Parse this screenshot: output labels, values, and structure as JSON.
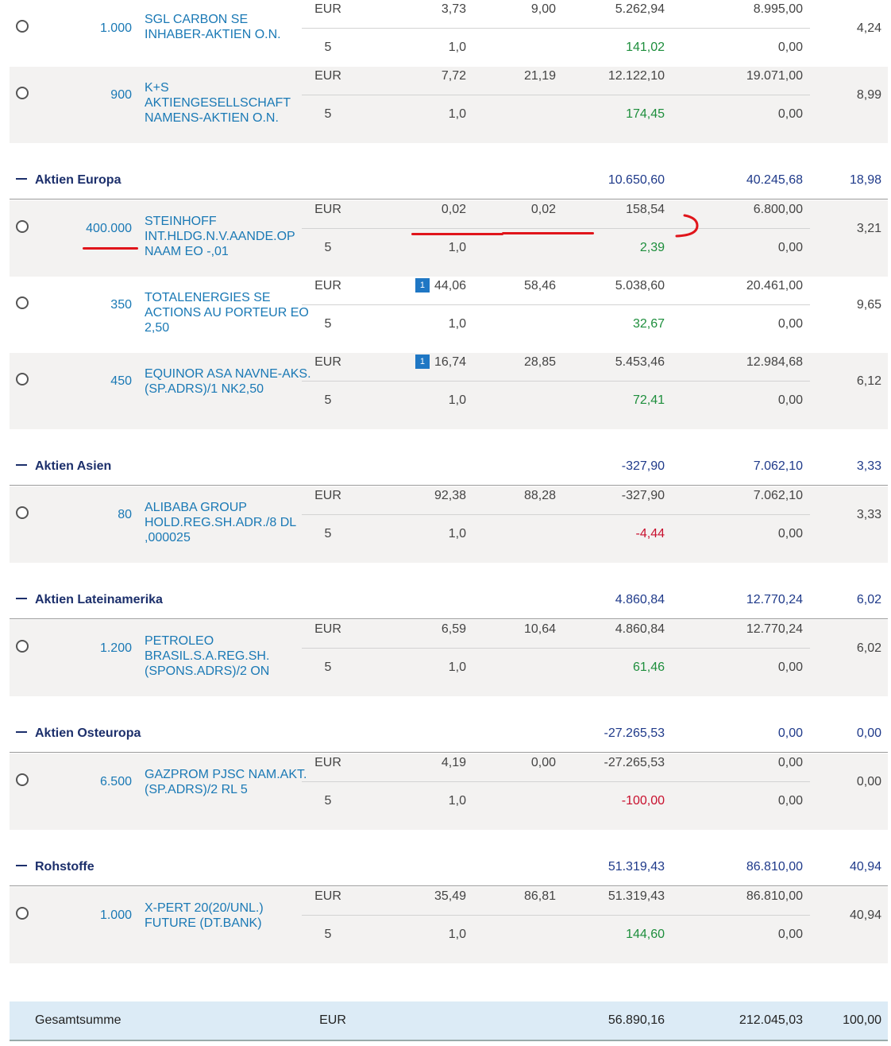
{
  "rows": [
    {
      "qty": "1.000",
      "name": "SGL CARBON SE INHABER-AKTIEN O.N.",
      "currency": "EUR",
      "buy": "3,73",
      "current": "9,00",
      "gain": "5.262,94",
      "value": "8.995,00",
      "pct": "4,24",
      "line2_left": "5",
      "line2_rate": "1,0",
      "gain_pct": "141,02",
      "gain_pct_color": "green",
      "line2_value": "0,00"
    },
    {
      "qty": "900",
      "name": "K+S AKTIENGESELLSCHAFT NAMENS-AKTIEN O.N.",
      "currency": "EUR",
      "buy": "7,72",
      "current": "21,19",
      "gain": "12.122,10",
      "value": "19.071,00",
      "pct": "8,99",
      "line2_left": "5",
      "line2_rate": "1,0",
      "gain_pct": "174,45",
      "gain_pct_color": "green",
      "line2_value": "0,00"
    },
    {
      "qty": "400.000",
      "name": "STEINHOFF INT.HLDG.N.V.AANDE.OP NAAM EO -,01",
      "currency": "EUR",
      "buy": "0,02",
      "current": "0,02",
      "gain": "158,54",
      "value": "6.800,00",
      "pct": "3,21",
      "line2_left": "5",
      "line2_rate": "1,0",
      "gain_pct": "2,39",
      "gain_pct_color": "green",
      "line2_value": "0,00"
    },
    {
      "qty": "350",
      "name": "TOTALENERGIES SE ACTIONS AU PORTEUR EO 2,50",
      "currency": "EUR",
      "badge": "1",
      "buy": "44,06",
      "current": "58,46",
      "gain": "5.038,60",
      "value": "20.461,00",
      "pct": "9,65",
      "line2_left": "5",
      "line2_rate": "1,0",
      "gain_pct": "32,67",
      "gain_pct_color": "green",
      "line2_value": "0,00"
    },
    {
      "qty": "450",
      "name": "EQUINOR ASA NAVNE-AKS. (SP.ADRS)/1 NK2,50",
      "currency": "EUR",
      "badge": "1",
      "buy": "16,74",
      "current": "28,85",
      "gain": "5.453,46",
      "value": "12.984,68",
      "pct": "6,12",
      "line2_left": "5",
      "line2_rate": "1,0",
      "gain_pct": "72,41",
      "gain_pct_color": "green",
      "line2_value": "0,00"
    },
    {
      "qty": "80",
      "name": "ALIBABA GROUP HOLD.REG.SH.ADR./8 DL ,000025",
      "currency": "EUR",
      "buy": "92,38",
      "current": "88,28",
      "gain": "-327,90",
      "value": "7.062,10",
      "pct": "3,33",
      "line2_left": "5",
      "line2_rate": "1,0",
      "gain_pct": "-4,44",
      "gain_pct_color": "red",
      "line2_value": "0,00"
    },
    {
      "qty": "1.200",
      "name": "PETROLEO BRASIL.S.A.REG.SH. (SPONS.ADRS)/2 ON",
      "currency": "EUR",
      "buy": "6,59",
      "current": "10,64",
      "gain": "4.860,84",
      "value": "12.770,24",
      "pct": "6,02",
      "line2_left": "5",
      "line2_rate": "1,0",
      "gain_pct": "61,46",
      "gain_pct_color": "green",
      "line2_value": "0,00"
    },
    {
      "qty": "6.500",
      "name": "GAZPROM PJSC NAM.AKT.(SP.ADRS)/2 RL 5",
      "currency": "EUR",
      "buy": "4,19",
      "current": "0,00",
      "gain": "-27.265,53",
      "value": "0,00",
      "pct": "0,00",
      "line2_left": "5",
      "line2_rate": "1,0",
      "gain_pct": "-100,00",
      "gain_pct_color": "red",
      "line2_value": "0,00"
    },
    {
      "qty": "1.000",
      "name": "X-PERT 20(20/UNL.) FUTURE (DT.BANK)",
      "currency": "EUR",
      "buy": "35,49",
      "current": "86,81",
      "gain": "51.319,43",
      "value": "86.810,00",
      "pct": "40,94",
      "line2_left": "5",
      "line2_rate": "1,0",
      "gain_pct": "144,60",
      "gain_pct_color": "green",
      "line2_value": "0,00"
    }
  ],
  "groups": [
    {
      "title": "Aktien Europa",
      "gain": "10.650,60",
      "value": "40.245,68",
      "pct": "18,98"
    },
    {
      "title": "Aktien Asien",
      "gain": "-327,90",
      "value": "7.062,10",
      "pct": "3,33"
    },
    {
      "title": "Aktien Lateinamerika",
      "gain": "4.860,84",
      "value": "12.770,24",
      "pct": "6,02"
    },
    {
      "title": "Aktien Osteuropa",
      "gain": "-27.265,53",
      "value": "0,00",
      "pct": "0,00"
    },
    {
      "title": "Rohstoffe",
      "gain": "51.319,43",
      "value": "86.810,00",
      "pct": "40,94"
    }
  ],
  "total": {
    "label": "Gesamtsumme",
    "currency": "EUR",
    "gain": "56.890,16",
    "value": "212.045,03",
    "pct": "100,00"
  },
  "colors": {
    "link": "#1a79b5",
    "group": "#1c2f6b",
    "gain_positive": "#1d8e3c",
    "gain_negative": "#c8102e",
    "annotation": "#e0151b"
  }
}
